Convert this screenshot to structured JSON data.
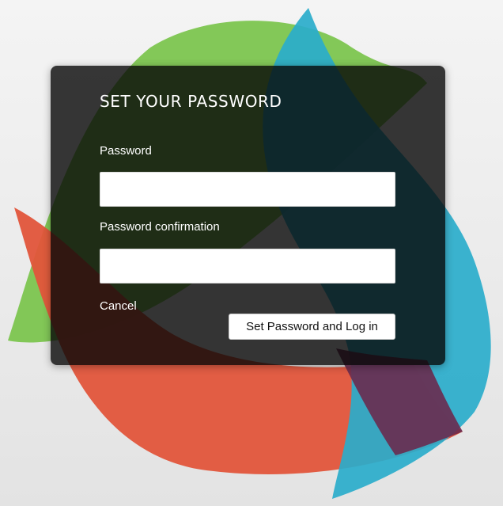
{
  "form": {
    "title": "SET YOUR PASSWORD",
    "password_label": "Password",
    "password_value": "",
    "confirmation_label": "Password confirmation",
    "confirmation_value": "",
    "cancel_label": "Cancel",
    "submit_label": "Set Password and Log in"
  },
  "colors": {
    "background": "#ececec",
    "panel": "#060606",
    "shape_green": "#7cc54f",
    "shape_blue": "#2aaccb",
    "shape_red": "#e2553b",
    "text": "#ffffff"
  }
}
